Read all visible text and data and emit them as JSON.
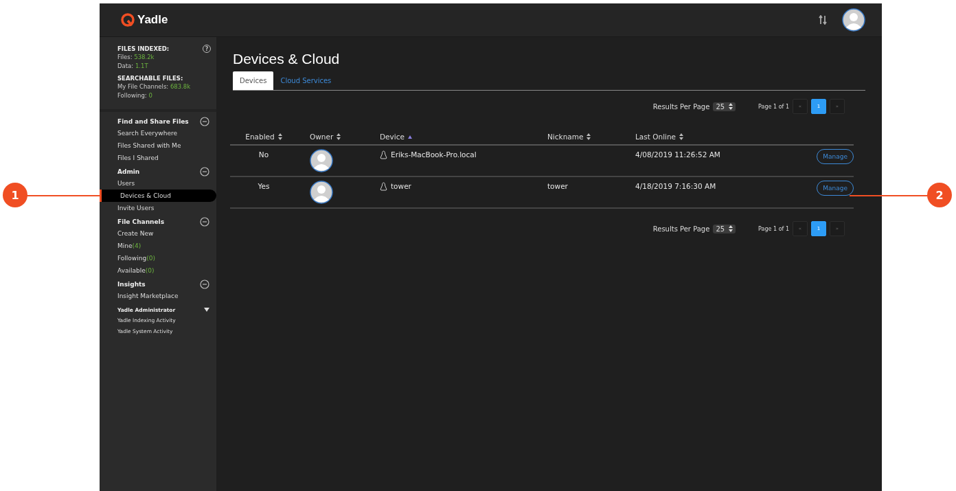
{
  "header": {
    "logo": "Yadle"
  },
  "stats": [
    {
      "heading": "FILES INDEXED:",
      "lines": [
        {
          "label": "Files:",
          "value": "538.2k"
        },
        {
          "label": "Data:",
          "value": "1.1T"
        }
      ]
    },
    {
      "heading": "SEARCHABLE FILES:",
      "lines": [
        {
          "label": "My File Channels:",
          "value": "683.8k"
        },
        {
          "label": "Following:",
          "value": "0"
        }
      ]
    }
  ],
  "help": "?",
  "nav_sections": [
    {
      "kind": "group",
      "title": "Find and Share Files",
      "items": [
        {
          "label": "Search Everywhere",
          "selected": false
        },
        {
          "label": "Files Shared with Me",
          "selected": false
        },
        {
          "label": "Files I Shared",
          "selected": false
        }
      ]
    },
    {
      "kind": "group",
      "title": "Admin",
      "items": [
        {
          "label": "Users",
          "selected": false
        },
        {
          "label": "Devices & Cloud",
          "selected": true
        },
        {
          "label": "Invite Users",
          "selected": false
        }
      ]
    },
    {
      "kind": "group",
      "title": "File Channels",
      "items": [
        {
          "label": "Create New",
          "selected": false
        },
        {
          "label": "Mine",
          "count": "(4)",
          "selected": false
        },
        {
          "label": "Following",
          "count": "(0)",
          "selected": false
        },
        {
          "label": "Available",
          "count": "(0)",
          "selected": false
        }
      ]
    },
    {
      "kind": "group",
      "title": "Insights",
      "items": [
        {
          "label": "Insight Marketplace",
          "selected": false
        }
      ]
    },
    {
      "kind": "menu",
      "title": "Yadle Administrator",
      "items": [
        {
          "label": "Yadle Indexing Activity",
          "selected": false
        },
        {
          "label": "Yadle System Activity",
          "selected": false
        }
      ]
    }
  ],
  "page_title": "Devices & Cloud",
  "tabs": [
    {
      "label": "Devices",
      "selected": true
    },
    {
      "label": "Cloud Services",
      "selected": false
    }
  ],
  "paginations": [
    {
      "results_label": "Results Per Page",
      "per_page": "25",
      "page_label": "Page 1 of 1",
      "prev": "«",
      "pages": [
        {
          "label": "1",
          "selected": true
        }
      ],
      "next": "»"
    },
    {
      "results_label": "Results Per Page",
      "per_page": "25",
      "page_label": "Page 1 of 1",
      "prev": "«",
      "pages": [
        {
          "label": "1",
          "selected": true
        }
      ],
      "next": "»"
    }
  ],
  "table": {
    "columns": [
      {
        "label": "Enabled",
        "sorted": false
      },
      {
        "label": "Owner",
        "sorted": false
      },
      {
        "label": "Device",
        "sorted": true
      },
      {
        "label": "Nickname",
        "sorted": false
      },
      {
        "label": "Last Online",
        "sorted": false
      }
    ],
    "rows": [
      {
        "enabled": "No",
        "device": "Eriks-MacBook-Pro.local",
        "last_online": "4/08/2019 11:26:52 AM",
        "action": "Manage"
      },
      {
        "enabled": "Yes",
        "device": "tower",
        "nickname": "tower",
        "last_online": "4/18/2019 7:16:30 AM",
        "action": "Manage"
      }
    ]
  },
  "callouts": [
    {
      "number": "1"
    },
    {
      "number": "2"
    }
  ]
}
